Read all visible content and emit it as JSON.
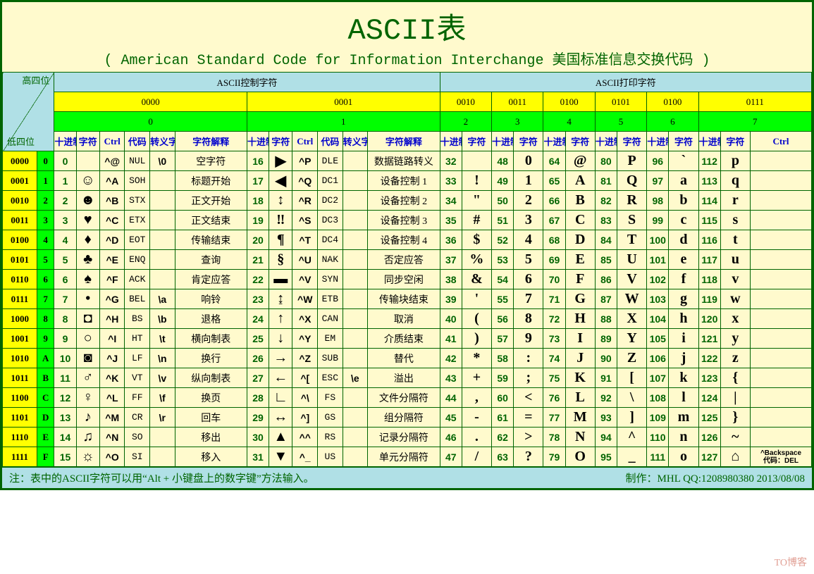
{
  "title": "ASCII表",
  "subtitle": "( American Standard Code for Information Interchange  美国标准信息交换代码 )",
  "corner_high": "高四位",
  "corner_low": "低四位",
  "section_ctrl": "ASCII控制字符",
  "section_print": "ASCII打印字符",
  "bin_high": [
    "0000",
    "0001",
    "0010",
    "0011",
    "0100",
    "0101",
    "0100",
    "0111"
  ],
  "dec_high": [
    "0",
    "1",
    "2",
    "3",
    "4",
    "5",
    "6",
    "7"
  ],
  "col_headers": {
    "dec": "十进制",
    "chr": "字符",
    "ctrl": "Ctrl",
    "code": "代码",
    "esc": "转义字符",
    "desc": "字符解释"
  },
  "bin_low": [
    "0000",
    "0001",
    "0010",
    "0011",
    "0100",
    "0101",
    "0110",
    "0111",
    "1000",
    "1001",
    "1010",
    "1011",
    "1100",
    "1101",
    "1110",
    "1111"
  ],
  "hex_low": [
    "0",
    "1",
    "2",
    "3",
    "4",
    "5",
    "6",
    "7",
    "8",
    "9",
    "A",
    "B",
    "C",
    "D",
    "E",
    "F"
  ],
  "control0": [
    {
      "dec": "0",
      "chr": "",
      "ctrl": "^@",
      "code": "NUL",
      "esc": "\\0",
      "desc": "空字符"
    },
    {
      "dec": "1",
      "chr": "☺",
      "ctrl": "^A",
      "code": "SOH",
      "esc": "",
      "desc": "标题开始"
    },
    {
      "dec": "2",
      "chr": "☻",
      "ctrl": "^B",
      "code": "STX",
      "esc": "",
      "desc": "正文开始"
    },
    {
      "dec": "3",
      "chr": "♥",
      "ctrl": "^C",
      "code": "ETX",
      "esc": "",
      "desc": "正文结束"
    },
    {
      "dec": "4",
      "chr": "♦",
      "ctrl": "^D",
      "code": "EOT",
      "esc": "",
      "desc": "传输结束"
    },
    {
      "dec": "5",
      "chr": "♣",
      "ctrl": "^E",
      "code": "ENQ",
      "esc": "",
      "desc": "查询"
    },
    {
      "dec": "6",
      "chr": "♠",
      "ctrl": "^F",
      "code": "ACK",
      "esc": "",
      "desc": "肯定应答"
    },
    {
      "dec": "7",
      "chr": "•",
      "ctrl": "^G",
      "code": "BEL",
      "esc": "\\a",
      "desc": "响铃"
    },
    {
      "dec": "8",
      "chr": "◘",
      "ctrl": "^H",
      "code": "BS",
      "esc": "\\b",
      "desc": "退格"
    },
    {
      "dec": "9",
      "chr": "○",
      "ctrl": "^I",
      "code": "HT",
      "esc": "\\t",
      "desc": "横向制表"
    },
    {
      "dec": "10",
      "chr": "◙",
      "ctrl": "^J",
      "code": "LF",
      "esc": "\\n",
      "desc": "换行"
    },
    {
      "dec": "11",
      "chr": "♂",
      "ctrl": "^K",
      "code": "VT",
      "esc": "\\v",
      "desc": "纵向制表"
    },
    {
      "dec": "12",
      "chr": "♀",
      "ctrl": "^L",
      "code": "FF",
      "esc": "\\f",
      "desc": "换页"
    },
    {
      "dec": "13",
      "chr": "♪",
      "ctrl": "^M",
      "code": "CR",
      "esc": "\\r",
      "desc": "回车"
    },
    {
      "dec": "14",
      "chr": "♫",
      "ctrl": "^N",
      "code": "SO",
      "esc": "",
      "desc": "移出"
    },
    {
      "dec": "15",
      "chr": "☼",
      "ctrl": "^O",
      "code": "SI",
      "esc": "",
      "desc": "移入"
    }
  ],
  "control1": [
    {
      "dec": "16",
      "chr": "▶",
      "ctrl": "^P",
      "code": "DLE",
      "esc": "",
      "desc": "数据链路转义"
    },
    {
      "dec": "17",
      "chr": "◀",
      "ctrl": "^Q",
      "code": "DC1",
      "esc": "",
      "desc": "设备控制 1"
    },
    {
      "dec": "18",
      "chr": "↕",
      "ctrl": "^R",
      "code": "DC2",
      "esc": "",
      "desc": "设备控制 2"
    },
    {
      "dec": "19",
      "chr": "‼",
      "ctrl": "^S",
      "code": "DC3",
      "esc": "",
      "desc": "设备控制 3"
    },
    {
      "dec": "20",
      "chr": "¶",
      "ctrl": "^T",
      "code": "DC4",
      "esc": "",
      "desc": "设备控制 4"
    },
    {
      "dec": "21",
      "chr": "§",
      "ctrl": "^U",
      "code": "NAK",
      "esc": "",
      "desc": "否定应答"
    },
    {
      "dec": "22",
      "chr": "▬",
      "ctrl": "^V",
      "code": "SYN",
      "esc": "",
      "desc": "同步空闲"
    },
    {
      "dec": "23",
      "chr": "↨",
      "ctrl": "^W",
      "code": "ETB",
      "esc": "",
      "desc": "传输块结束"
    },
    {
      "dec": "24",
      "chr": "↑",
      "ctrl": "^X",
      "code": "CAN",
      "esc": "",
      "desc": "取消"
    },
    {
      "dec": "25",
      "chr": "↓",
      "ctrl": "^Y",
      "code": "EM",
      "esc": "",
      "desc": "介质结束"
    },
    {
      "dec": "26",
      "chr": "→",
      "ctrl": "^Z",
      "code": "SUB",
      "esc": "",
      "desc": "替代"
    },
    {
      "dec": "27",
      "chr": "←",
      "ctrl": "^[",
      "code": "ESC",
      "esc": "\\e",
      "desc": "溢出"
    },
    {
      "dec": "28",
      "chr": "∟",
      "ctrl": "^\\",
      "code": "FS",
      "esc": "",
      "desc": "文件分隔符"
    },
    {
      "dec": "29",
      "chr": "↔",
      "ctrl": "^]",
      "code": "GS",
      "esc": "",
      "desc": "组分隔符"
    },
    {
      "dec": "30",
      "chr": "▲",
      "ctrl": "^^",
      "code": "RS",
      "esc": "",
      "desc": "记录分隔符"
    },
    {
      "dec": "31",
      "chr": "▼",
      "ctrl": "^_",
      "code": "US",
      "esc": "",
      "desc": "单元分隔符"
    }
  ],
  "printable": [
    [
      "32",
      "",
      "48",
      "0",
      "64",
      "@",
      "80",
      "P",
      "96",
      "`",
      "112",
      "p",
      ""
    ],
    [
      "33",
      "!",
      "49",
      "1",
      "65",
      "A",
      "81",
      "Q",
      "97",
      "a",
      "113",
      "q",
      ""
    ],
    [
      "34",
      "\"",
      "50",
      "2",
      "66",
      "B",
      "82",
      "R",
      "98",
      "b",
      "114",
      "r",
      ""
    ],
    [
      "35",
      "#",
      "51",
      "3",
      "67",
      "C",
      "83",
      "S",
      "99",
      "c",
      "115",
      "s",
      ""
    ],
    [
      "36",
      "$",
      "52",
      "4",
      "68",
      "D",
      "84",
      "T",
      "100",
      "d",
      "116",
      "t",
      ""
    ],
    [
      "37",
      "%",
      "53",
      "5",
      "69",
      "E",
      "85",
      "U",
      "101",
      "e",
      "117",
      "u",
      ""
    ],
    [
      "38",
      "&",
      "54",
      "6",
      "70",
      "F",
      "86",
      "V",
      "102",
      "f",
      "118",
      "v",
      ""
    ],
    [
      "39",
      "'",
      "55",
      "7",
      "71",
      "G",
      "87",
      "W",
      "103",
      "g",
      "119",
      "w",
      ""
    ],
    [
      "40",
      "(",
      "56",
      "8",
      "72",
      "H",
      "88",
      "X",
      "104",
      "h",
      "120",
      "x",
      ""
    ],
    [
      "41",
      ")",
      "57",
      "9",
      "73",
      "I",
      "89",
      "Y",
      "105",
      "i",
      "121",
      "y",
      ""
    ],
    [
      "42",
      "*",
      "58",
      ":",
      "74",
      "J",
      "90",
      "Z",
      "106",
      "j",
      "122",
      "z",
      ""
    ],
    [
      "43",
      "+",
      "59",
      ";",
      "75",
      "K",
      "91",
      "[",
      "107",
      "k",
      "123",
      "{",
      ""
    ],
    [
      "44",
      ",",
      "60",
      "<",
      "76",
      "L",
      "92",
      "\\",
      "108",
      "l",
      "124",
      "|",
      ""
    ],
    [
      "45",
      "-",
      "61",
      "=",
      "77",
      "M",
      "93",
      "]",
      "109",
      "m",
      "125",
      "}",
      ""
    ],
    [
      "46",
      ".",
      "62",
      ">",
      "78",
      "N",
      "94",
      "^",
      "110",
      "n",
      "126",
      "~",
      ""
    ],
    [
      "47",
      "/",
      "63",
      "?",
      "79",
      "O",
      "95",
      "_",
      "111",
      "o",
      "127",
      "⌂",
      "^Backspace 代码：DEL"
    ]
  ],
  "footer_note": "注：表中的ASCII字符可以用“Alt + 小键盘上的数字键”方法输入。",
  "footer_credit": "制作：MHL   QQ:1208980380     2013/08/08",
  "watermark2": "TO博客"
}
